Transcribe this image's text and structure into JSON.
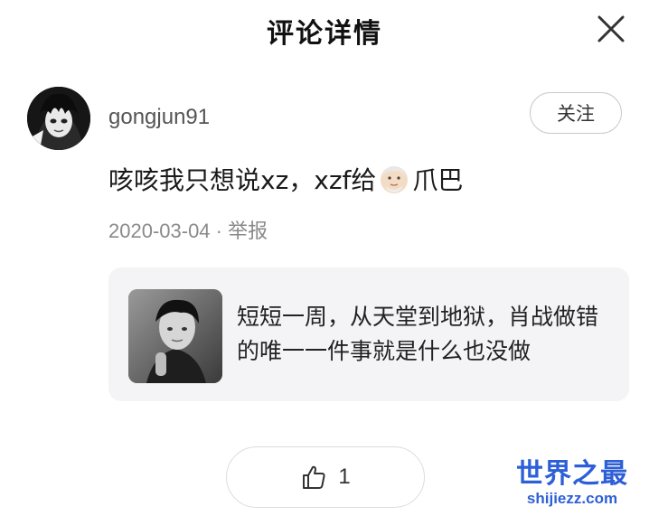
{
  "header": {
    "title": "评论详情"
  },
  "user": {
    "name": "gongjun91",
    "follow_label": "关注"
  },
  "comment": {
    "text_before": "咳咳我只想说xz，xzf给",
    "text_after": "爪巴",
    "emoji": "old-man-face-emoji"
  },
  "meta": {
    "date": "2020-03-04",
    "separator": " · ",
    "report_label": "举报"
  },
  "quote": {
    "text": "短短一周，从天堂到地狱，肖战做错的唯一一件事就是什么也没做"
  },
  "like": {
    "count": "1"
  },
  "watermark": {
    "main": "世界之最",
    "sub": "shijiezz.com"
  },
  "colors": {
    "accent": "#2d5fd6",
    "card_bg": "#f4f4f6",
    "meta_text": "#8a8a8a"
  }
}
